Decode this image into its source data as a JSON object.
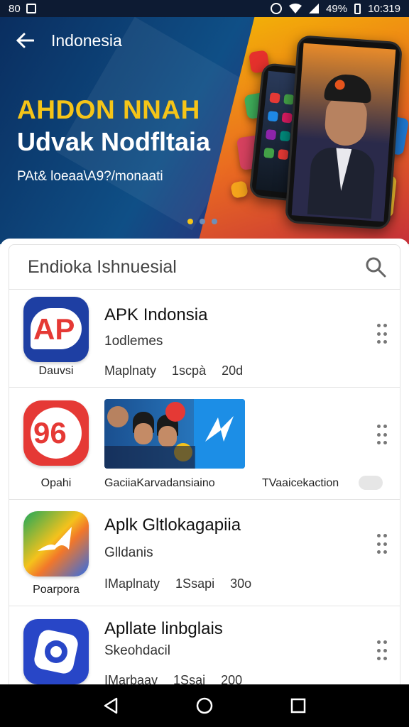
{
  "status_bar": {
    "left_text": "80",
    "battery": "49%",
    "time": "10:319"
  },
  "header": {
    "title": "Indonesia"
  },
  "banner": {
    "title_line1": "AHDON NNAH",
    "title_line2": "Udvak Nodfltaia",
    "subtitle": "PAt& loeaa\\A9?/monaati"
  },
  "search": {
    "text": "Endioka Ishnuesial"
  },
  "apps": [
    {
      "icon_text": "AP",
      "caption": "Dauvsi",
      "title": "APK Indonsia",
      "subtitle": "1odlemes",
      "meta": [
        "Maplnaty",
        "1scpà",
        "20d"
      ]
    },
    {
      "icon_text": "96",
      "caption": "Opahi",
      "banner_caption": "GaciiaKarvadansiaino",
      "side_label": "TVaaicekaction"
    },
    {
      "caption": "Poarpora",
      "title": "Aplk Gltlokagapiia",
      "subtitle": "Glldanis",
      "meta": [
        "IMaplnaty",
        "1Ssapi",
        "30o"
      ]
    },
    {
      "caption": "",
      "title": "Apllate linbglais",
      "subtitle": "Skeohdacil",
      "meta": [
        "IMarbaay",
        "1Ssai",
        "200"
      ]
    }
  ],
  "colors": {
    "status_bg": "#0d1b33",
    "accent_yellow": "#f5c518",
    "app1_red": "#e53935",
    "app1_blue": "#1e3fa3"
  }
}
